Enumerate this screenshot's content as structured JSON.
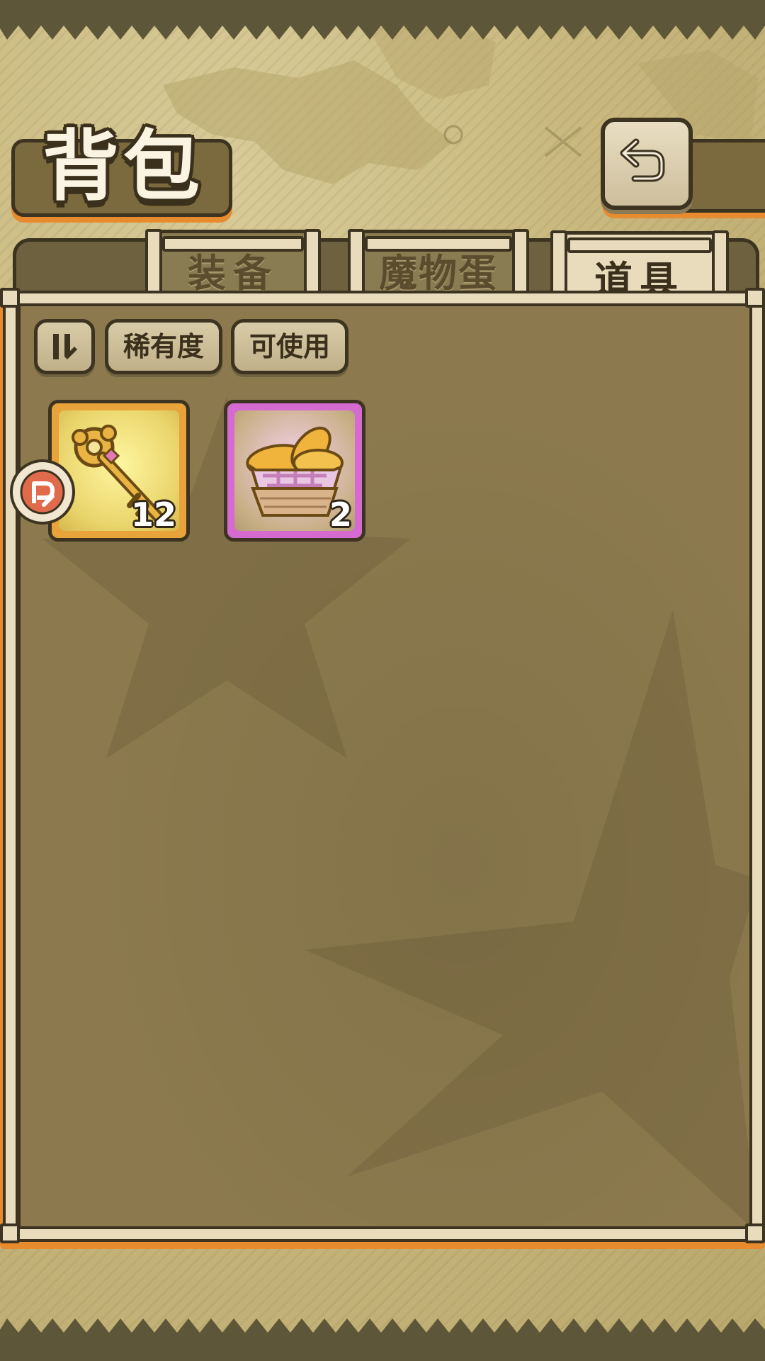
{
  "header": {
    "title": "背包",
    "back_icon": "back-arrow-icon"
  },
  "tabs": [
    {
      "label": "装备",
      "active": false
    },
    {
      "label": "魔物蛋",
      "active": false
    },
    {
      "label": "道具",
      "active": true
    }
  ],
  "filters": {
    "sort_icon": "sort-toggle-icon",
    "rarity_label": "稀有度",
    "usable_label": "可使用"
  },
  "items": [
    {
      "name": "golden-key",
      "icon": "golden-key-icon",
      "count": "12",
      "rarity_color": "#e8a33a"
    },
    {
      "name": "bread-basket",
      "icon": "bread-basket-icon",
      "count": "2",
      "rarity_color": "#d56ad0"
    }
  ],
  "colors": {
    "accent_orange": "#e88a2e",
    "panel_brown": "#8c7a4e",
    "outline": "#3c3320"
  }
}
